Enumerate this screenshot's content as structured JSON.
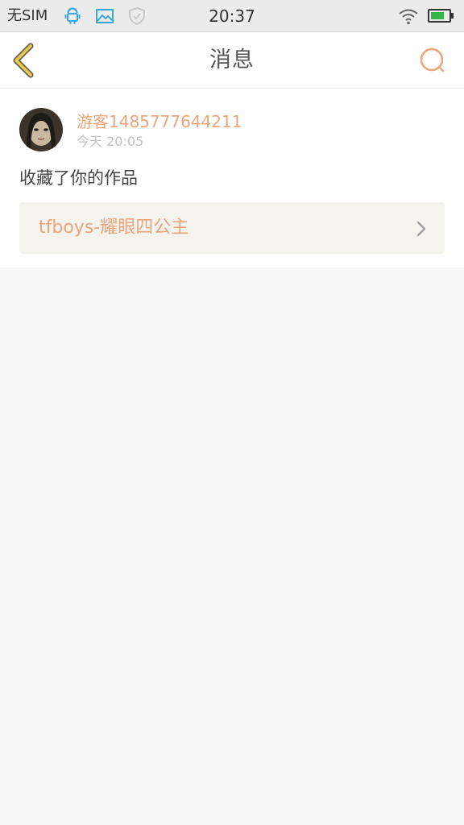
{
  "status_bar": {
    "carrier": "无SIM",
    "time": "20:37",
    "icons": [
      "android-icon",
      "image-icon",
      "shield-icon",
      "wifi-icon",
      "battery-icon"
    ]
  },
  "header": {
    "title": "消息",
    "back_icon": "chevron-left-icon",
    "search_icon": "search-icon"
  },
  "message": {
    "username": "游客1485777644211",
    "timestamp": "今天 20:05",
    "text": "收藏了你的作品",
    "work_title": "tfboys-耀眼四公主"
  },
  "colors": {
    "accent": "#eaa57d",
    "back_icon": "#e8c84a",
    "background": "#f7f7f7"
  }
}
